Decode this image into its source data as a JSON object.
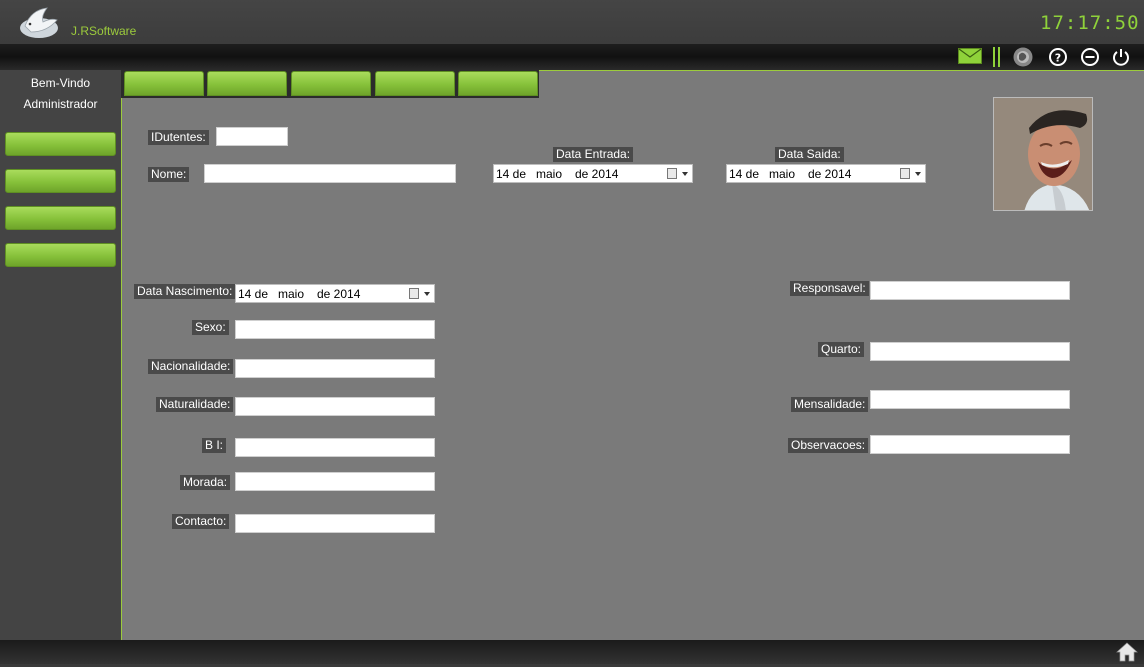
{
  "app": {
    "brand": "J.RSoftware",
    "clock": "17:17:50"
  },
  "toolbar_icons": [
    "mail-icon",
    "divider-icon",
    "globe-icon",
    "help-icon",
    "minimize-icon",
    "power-icon"
  ],
  "sidebar": {
    "welcome": "Bem-Vindo",
    "user": "Administrador",
    "buttons": [
      "",
      "",
      "",
      ""
    ]
  },
  "tabs": [
    "",
    "",
    "",
    "",
    ""
  ],
  "form": {
    "idutentes": {
      "label": "IDutentes:",
      "value": ""
    },
    "nome": {
      "label": "Nome:",
      "value": ""
    },
    "data_entrada": {
      "label": "Data Entrada:",
      "day": "14 de",
      "month": "maio",
      "year": "de 2014"
    },
    "data_saida": {
      "label": "Data Saida:",
      "day": "14 de",
      "month": "maio",
      "year": "de 2014"
    },
    "data_nascimento": {
      "label": "Data Nascimento:",
      "day": "14 de",
      "month": "maio",
      "year": "de 2014"
    },
    "sexo": {
      "label": "Sexo:",
      "value": ""
    },
    "nacionalidade": {
      "label": "Nacionalidade:",
      "value": ""
    },
    "naturalidade": {
      "label": "Naturalidade:",
      "value": ""
    },
    "bi": {
      "label": "B I:",
      "value": ""
    },
    "morada": {
      "label": "Morada:",
      "value": ""
    },
    "contacto": {
      "label": "Contacto:",
      "value": ""
    },
    "responsavel": {
      "label": "Responsavel:",
      "value": ""
    },
    "quarto": {
      "label": "Quarto:",
      "value": ""
    },
    "mensalidade": {
      "label": "Mensalidade:",
      "value": ""
    },
    "observacoes": {
      "label": "Observacoes:",
      "value": ""
    }
  },
  "colors": {
    "accent_green": "#8fd23a",
    "panel_gray": "#7a7a7a",
    "dark_bg": "#3a3a3a"
  }
}
